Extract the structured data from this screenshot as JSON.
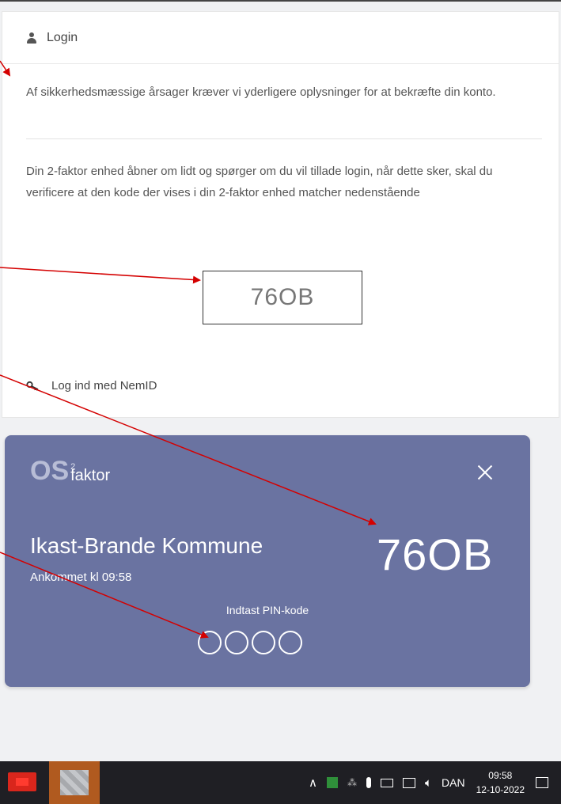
{
  "login": {
    "title": "Login",
    "intro": "Af sikkerhedsmæssige årsager kræver vi yderligere oplysninger for at bekræfte din konto.",
    "info": "Din 2-faktor enhed åbner om lidt og spørger om du vil tillade login, når dette sker, skal du verificere at den kode der vises i din 2-faktor enhed matcher nedenstående",
    "code": "76OB",
    "nemid_link": "Log ind med NemID"
  },
  "notification": {
    "logo_os": "OS",
    "logo_sup": "2",
    "logo_faktor": "faktor",
    "organization": "Ikast-Brande Kommune",
    "arrived": "Ankommet kl 09:58",
    "code": "76OB",
    "pin_label": "Indtast PIN-kode",
    "pin_digits": 4
  },
  "taskbar": {
    "language": "DAN",
    "time": "09:58",
    "date": "12-10-2022"
  },
  "colors": {
    "card": "#6a73a1",
    "arrow": "#d40000",
    "taskbar": "#1f1f24"
  }
}
